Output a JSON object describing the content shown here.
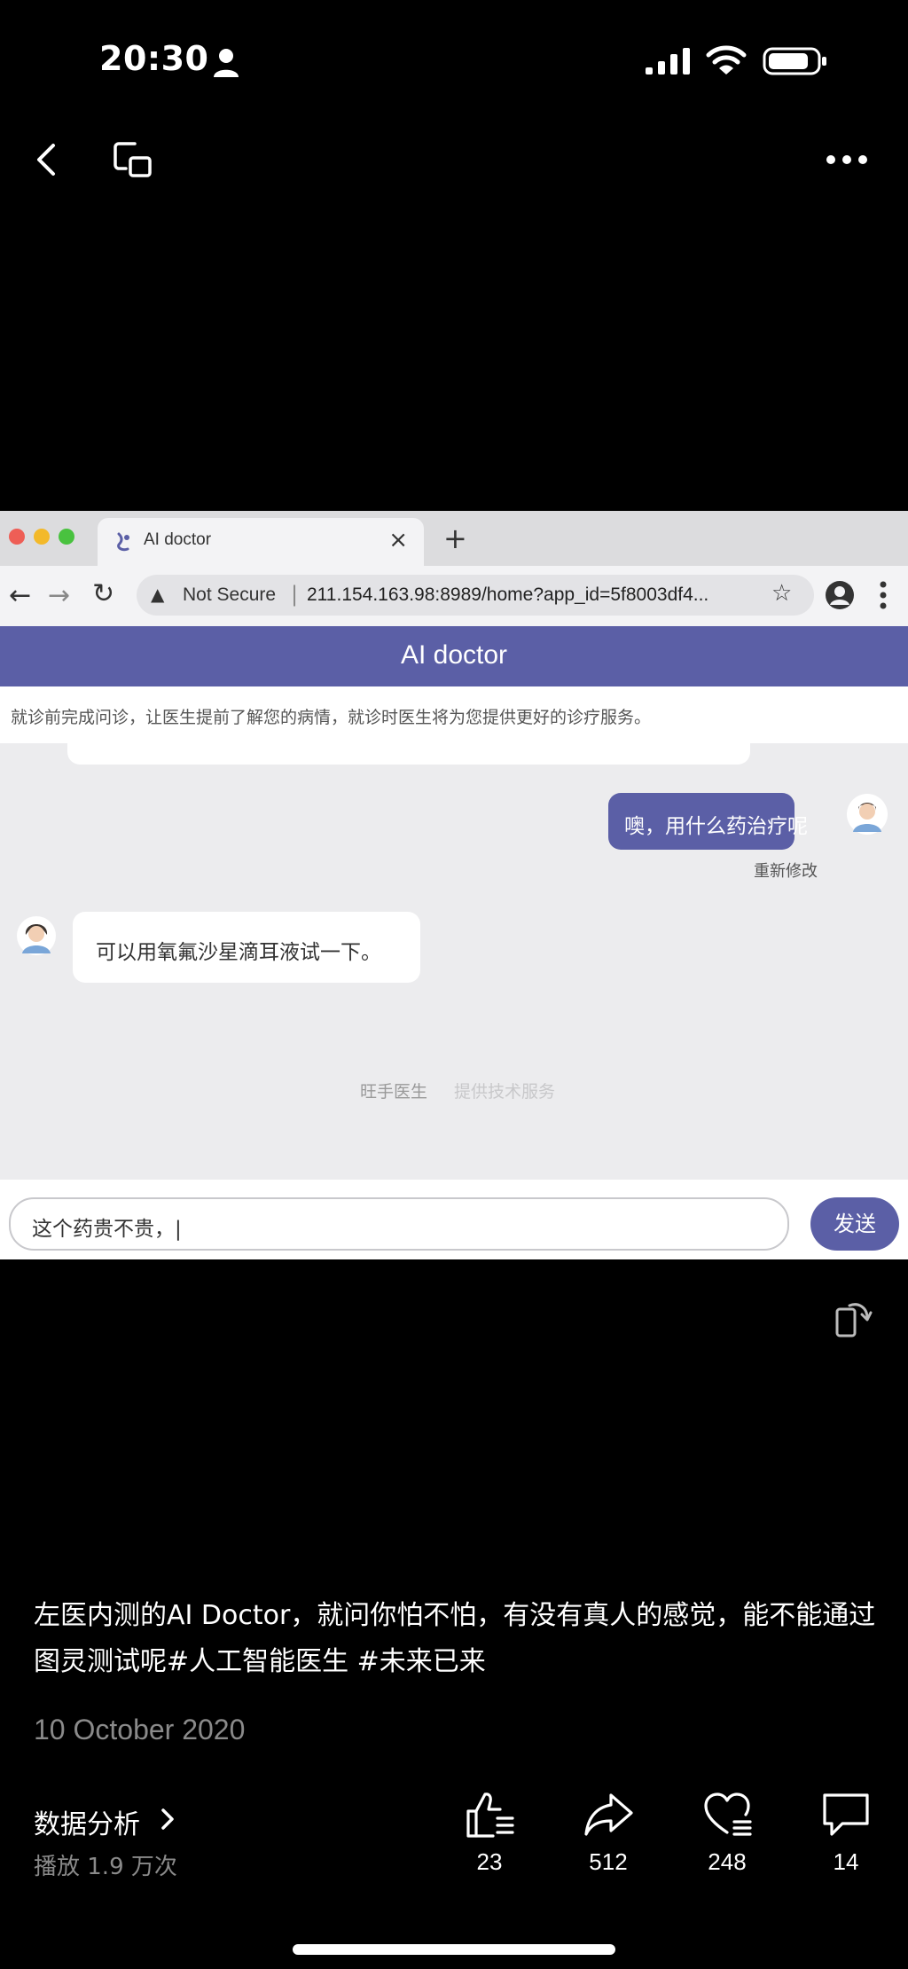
{
  "status_bar": {
    "time": "20:30",
    "icons": [
      "person-icon",
      "cellular-signal-icon",
      "wifi-icon",
      "battery-icon"
    ]
  },
  "top_nav": {
    "icons": [
      "back-icon",
      "picture-in-picture-icon",
      "more-icon"
    ]
  },
  "video": {
    "browser": {
      "tab_title": "AI doctor",
      "tab_close": "×",
      "new_tab": "+",
      "security_label": "Not Secure",
      "url": "211.154.163.98:8989/home?app_id=5f8003df4..."
    },
    "app": {
      "title": "AI doctor",
      "notice": "就诊前完成问诊，让医生提前了解您的病情，就诊时医生将为您提供更好的诊疗服务。",
      "messages": {
        "user": "噢，用什么药治疗呢",
        "edit": "重新修改",
        "doctor": "可以用氧氟沙星滴耳液试一下。"
      },
      "footer": [
        "旺手医生",
        "提供技术服务"
      ],
      "input_value": "这个药贵不贵，|",
      "send_label": "发送"
    },
    "accent_color": "#5b5fa6"
  },
  "post": {
    "caption": "左医内测的AI Doctor，就问你怕不怕，有没有真人的感觉，能不能通过图灵测试呢#人工智能医生 #未来已来",
    "date": "10 October 2020",
    "analytics_label": "数据分析",
    "plays": "播放 1.9 万次"
  },
  "actions": {
    "like": "23",
    "share": "512",
    "favorite": "248",
    "comment": "14"
  }
}
